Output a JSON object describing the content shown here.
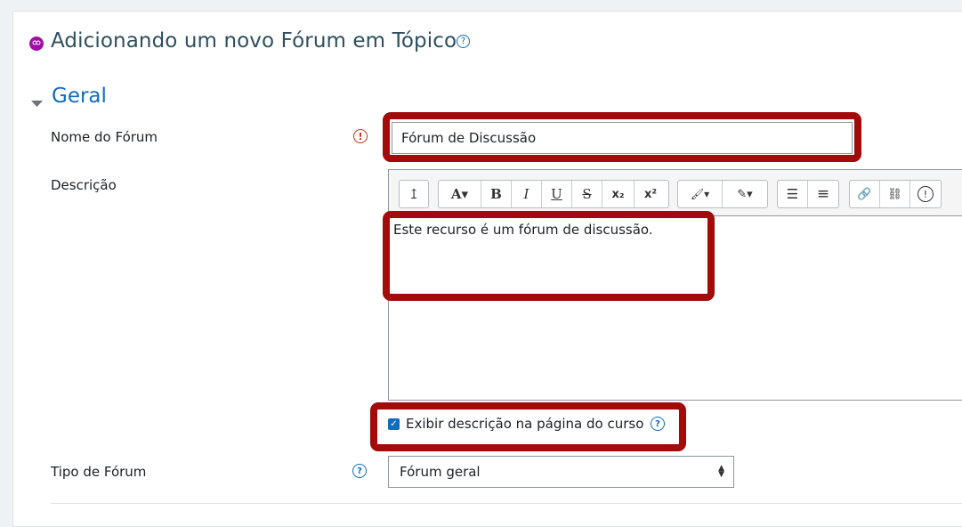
{
  "page": {
    "title": "Adicionando um novo Fórum em Tópico",
    "help_glyph": "?",
    "module_icon": "forum-icon",
    "accent_color": "#a10ea4"
  },
  "section": {
    "title": "Geral",
    "collapse_icon": "caret-down-icon"
  },
  "fields": {
    "name": {
      "label": "Nome do Fórum",
      "required_glyph": "!",
      "value": "Fórum de Discussão"
    },
    "description": {
      "label": "Descrição",
      "value": "Este recurso é um fórum de discussão.",
      "toolbar": [
        {
          "name": "toolbar-toggle-icon",
          "glyph": "↥"
        },
        {
          "name": "font-style-icon",
          "glyph": "A▾"
        },
        {
          "name": "bold-icon",
          "glyph": "B"
        },
        {
          "name": "italic-icon",
          "glyph": "I"
        },
        {
          "name": "underline-icon",
          "glyph": "U"
        },
        {
          "name": "strikethrough-icon",
          "glyph": "S"
        },
        {
          "name": "subscript-icon",
          "glyph": "x₂"
        },
        {
          "name": "superscript-icon",
          "glyph": "x²"
        },
        {
          "name": "text-color-icon",
          "glyph": "🖌▾"
        },
        {
          "name": "background-color-icon",
          "glyph": "✎▾"
        },
        {
          "name": "unordered-list-icon",
          "glyph": "☰"
        },
        {
          "name": "ordered-list-icon",
          "glyph": "≡"
        },
        {
          "name": "link-icon",
          "glyph": "🔗"
        },
        {
          "name": "unlink-icon",
          "glyph": "⛓"
        },
        {
          "name": "accessibility-checker-icon",
          "glyph": "!"
        }
      ]
    },
    "show_description": {
      "label": "Exibir descrição na página do curso",
      "checked": true,
      "help_glyph": "?"
    },
    "forum_type": {
      "label": "Tipo de Fórum",
      "help_glyph": "?",
      "selected": "Fórum geral"
    }
  },
  "colors": {
    "highlight": "#a30a0a",
    "link_blue": "#0f6cbf",
    "required_red": "#ca3120"
  }
}
